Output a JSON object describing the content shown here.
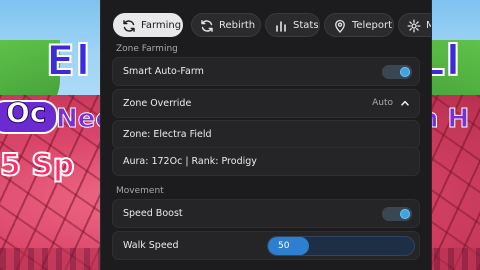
{
  "background": {
    "text_left": "El",
    "text_right": "Ll",
    "oc_text": "Oc",
    "need_text": "Need",
    "nh_text": "n H",
    "sp_text": "5 Sp"
  },
  "tabs": [
    {
      "label": "Farming",
      "icon": "refresh-icon",
      "active": true
    },
    {
      "label": "Rebirth",
      "icon": "refresh-icon",
      "active": false
    },
    {
      "label": "Stats",
      "icon": "bar-chart-icon",
      "active": false
    },
    {
      "label": "Teleport",
      "icon": "map-pin-icon",
      "active": false
    },
    {
      "label": "Mi",
      "icon": "gear-icon",
      "active": false
    }
  ],
  "zone_farming": {
    "header": "Zone Farming",
    "smart_auto_farm": {
      "label": "Smart Auto-Farm",
      "enabled": true
    },
    "zone_override": {
      "label": "Zone Override",
      "value": "Auto"
    },
    "zone_info": "Zone: Electra Field",
    "aura_info": "Aura: 172Oc | Rank: Prodigy"
  },
  "movement": {
    "header": "Movement",
    "speed_boost": {
      "label": "Speed Boost",
      "enabled": true
    },
    "walk_speed": {
      "label": "Walk Speed",
      "value": "50",
      "fraction": 0.28
    }
  },
  "colors": {
    "accent": "#3ea3e0",
    "panel_bg": "#1c1c1e",
    "row_bg": "#252527"
  }
}
